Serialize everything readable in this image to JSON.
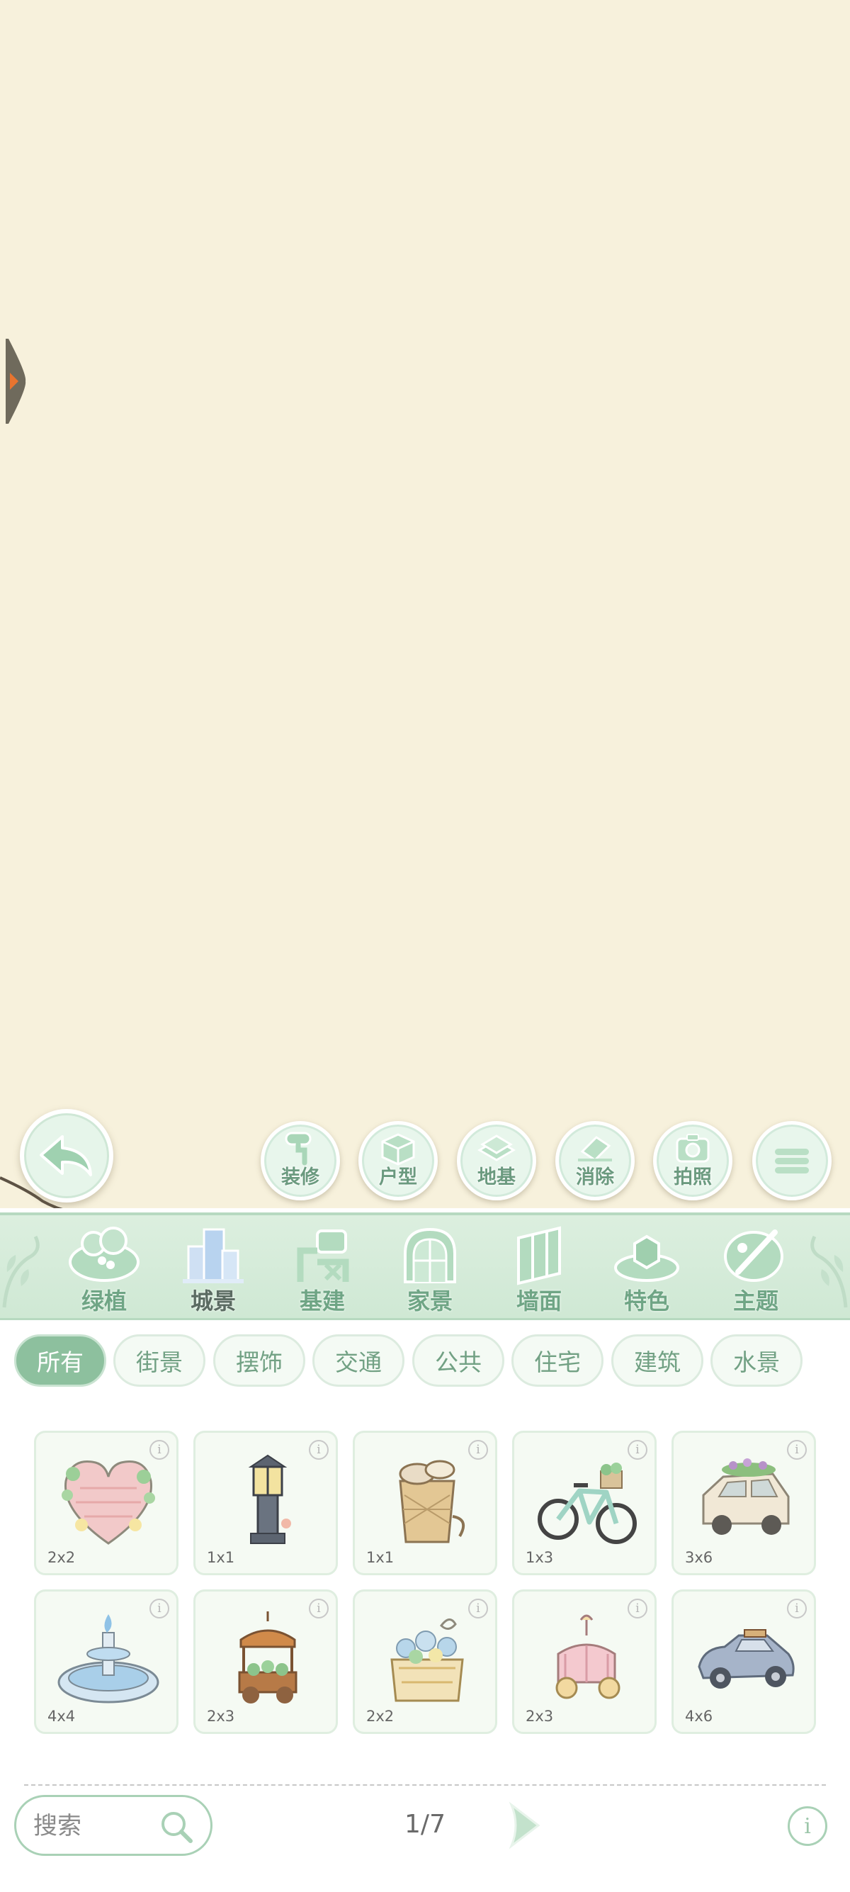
{
  "toolbar": {
    "tools": [
      {
        "label": "装修",
        "icon": "paint-roller-icon"
      },
      {
        "label": "户型",
        "icon": "room-layout-icon"
      },
      {
        "label": "地基",
        "icon": "foundation-icon"
      },
      {
        "label": "消除",
        "icon": "eraser-icon"
      },
      {
        "label": "拍照",
        "icon": "camera-icon"
      },
      {
        "label": "",
        "icon": "menu-icon"
      }
    ]
  },
  "categories": [
    {
      "label": "绿植",
      "icon": "plant-icon",
      "active": false
    },
    {
      "label": "城景",
      "icon": "city-buildings-icon",
      "active": true
    },
    {
      "label": "基建",
      "icon": "construction-crane-icon",
      "active": false
    },
    {
      "label": "家景",
      "icon": "home-arch-icon",
      "active": false
    },
    {
      "label": "墙面",
      "icon": "wall-panel-icon",
      "active": false
    },
    {
      "label": "特色",
      "icon": "special-block-icon",
      "active": false
    },
    {
      "label": "主题",
      "icon": "theme-palette-icon",
      "active": false
    }
  ],
  "subfilters": [
    {
      "label": "所有",
      "active": true
    },
    {
      "label": "街景",
      "active": false
    },
    {
      "label": "摆饰",
      "active": false
    },
    {
      "label": "交通",
      "active": false
    },
    {
      "label": "公共",
      "active": false
    },
    {
      "label": "住宅",
      "active": false
    },
    {
      "label": "建筑",
      "active": false
    },
    {
      "label": "水景",
      "active": false
    }
  ],
  "items": [
    {
      "size": "2x2",
      "icon": "heart-flower-arch-icon"
    },
    {
      "size": "1x1",
      "icon": "street-lamp-icon"
    },
    {
      "size": "1x1",
      "icon": "mushroom-basket-icon"
    },
    {
      "size": "1x3",
      "icon": "bicycle-icon"
    },
    {
      "size": "3x6",
      "icon": "flower-roof-car-icon"
    },
    {
      "size": "4x4",
      "icon": "fountain-icon"
    },
    {
      "size": "2x3",
      "icon": "flower-cart-icon"
    },
    {
      "size": "2x2",
      "icon": "flower-planter-icon"
    },
    {
      "size": "2x3",
      "icon": "carousel-carriage-icon"
    },
    {
      "size": "4x6",
      "icon": "vintage-car-icon"
    }
  ],
  "search": {
    "placeholder": "搜索"
  },
  "pagination": {
    "text": "1/7"
  },
  "colors": {
    "canvas": "#f7f1dc",
    "accent_green": "#8dc09e",
    "category_bar": "#d5ebd9",
    "label_green": "#6fa585"
  }
}
